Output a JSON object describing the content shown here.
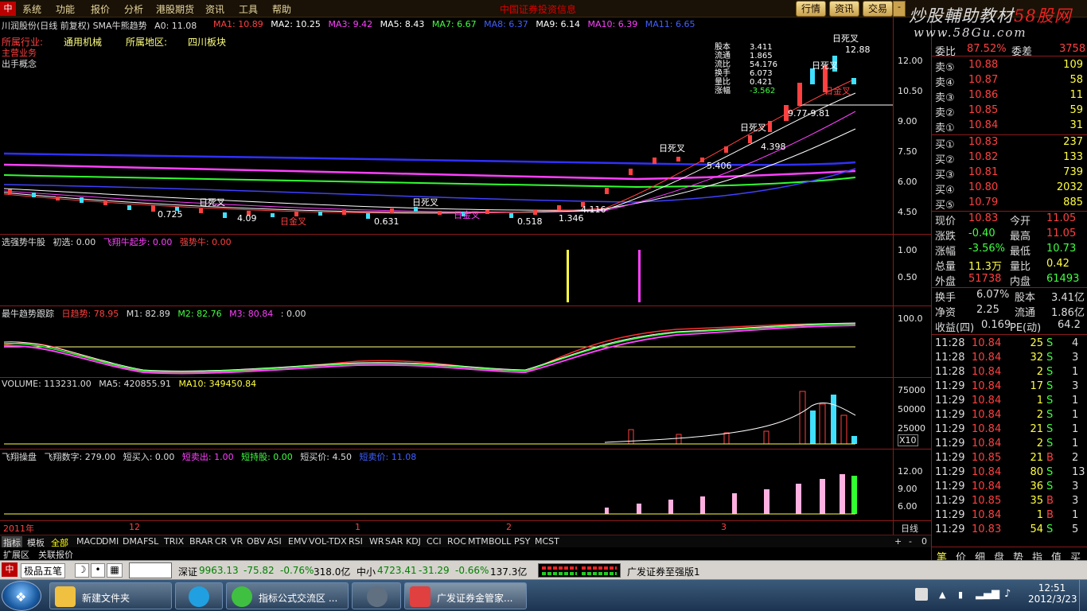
{
  "menubar": {
    "logo": "中",
    "items": [
      "系统",
      "功能",
      "报价",
      "分析",
      "港股期货",
      "资讯",
      "工具",
      "帮助"
    ],
    "center_title": "中国证券投资信息",
    "tabs": [
      "行情",
      "资讯",
      "交易"
    ],
    "minimize": "-"
  },
  "watermark": {
    "text": "炒股輔助教材",
    "accent": "58股网",
    "url": "www.58Gu.com"
  },
  "main_chart": {
    "title": "川润股份(日线 前复权) SMA牛熊趋势",
    "a0": "A0: 11.08",
    "ma": [
      {
        "label": "MA1: 10.89",
        "color": "#ff4040"
      },
      {
        "label": "MA2: 10.25",
        "color": "#ffffff"
      },
      {
        "label": "MA3: 9.42",
        "color": "#ff40ff"
      },
      {
        "label": "MA5: 8.43",
        "color": "#ffffff"
      },
      {
        "label": "MA7: 6.67",
        "color": "#40ff40"
      },
      {
        "label": "MA8: 6.37",
        "color": "#4040ff"
      },
      {
        "label": "MA9: 6.14",
        "color": "#ffffff"
      },
      {
        "label": "MA10: 6.39",
        "color": "#ff40ff"
      },
      {
        "label": "MA11: 6.65",
        "color": "#4040ff"
      }
    ],
    "info": {
      "industry_label": "所属行业:",
      "industry": "通用机械",
      "region_label": "所属地区:",
      "region": "四川板块",
      "line3": "主营业务",
      "line4": "出手概念"
    },
    "stats": [
      {
        "k": "股本",
        "v": "3.411"
      },
      {
        "k": "流通",
        "v": "1.865"
      },
      {
        "k": "流比",
        "v": "54.176"
      },
      {
        "k": "换手",
        "v": "6.073"
      },
      {
        "k": "量比",
        "v": "0.421"
      },
      {
        "k": "涨幅",
        "v": "-3.562"
      }
    ],
    "axis": [
      "12.00",
      "10.50",
      "9.00",
      "7.50",
      "6.00",
      "4.50"
    ],
    "annotations": {
      "dead_cross": "日死叉",
      "gold_cross": "日金叉",
      "v725": "0.725",
      "v409": "4.09",
      "v631": "0.631",
      "v518": "0.518",
      "v1346": "1.346",
      "v4116": "4.116",
      "v5406": "5.406",
      "v4398": "4.398",
      "v977": "9.77-9.81",
      "v1288": "12.88"
    }
  },
  "panel2": {
    "name": "选强势牛股",
    "items": [
      {
        "label": "初选: 0.00",
        "color": "#dddddd"
      },
      {
        "label": "飞翔牛起步: 0.00",
        "color": "#ff40ff"
      },
      {
        "label": "强势牛: 0.00",
        "color": "#ff4040"
      }
    ],
    "axis": [
      "1.00",
      "0.50"
    ]
  },
  "panel3": {
    "name": "最牛趋势跟踪",
    "items": [
      {
        "label": "日趋势: 78.95",
        "color": "#ff4040"
      },
      {
        "label": "M1: 82.89",
        "color": "#dddddd"
      },
      {
        "label": "M2: 82.76",
        "color": "#40ff40"
      },
      {
        "label": "M3: 80.84",
        "color": "#ff40ff"
      },
      {
        "label": ": 0.00",
        "color": "#dddddd"
      }
    ],
    "axis": [
      "100.0"
    ]
  },
  "panel4": {
    "name": "VOLUME: 113231.00",
    "items": [
      {
        "label": "MA5: 420855.91",
        "color": "#dddddd"
      },
      {
        "label": "MA10: 349450.84",
        "color": "#ffff40"
      }
    ],
    "axis": [
      "75000",
      "50000",
      "25000"
    ],
    "multiplier": "X10"
  },
  "panel5": {
    "name": "飞翔操盘",
    "items": [
      {
        "label": "飞翔数字: 279.00",
        "color": "#dddddd"
      },
      {
        "label": "短买入: 0.00",
        "color": "#dddddd"
      },
      {
        "label": "短卖出: 1.00",
        "color": "#ff40ff"
      },
      {
        "label": "短持股: 0.00",
        "color": "#40ff40"
      },
      {
        "label": "短买价: 4.50",
        "color": "#dddddd"
      },
      {
        "label": "短卖价: 11.08",
        "color": "#4060ff"
      }
    ],
    "axis": [
      "12.00",
      "9.00",
      "6.00"
    ]
  },
  "date_axis": {
    "labels": [
      "2011年",
      "12",
      "1",
      "2",
      "3"
    ],
    "period": "日线"
  },
  "indicator_tabs": [
    "指标",
    "模板",
    "全部",
    "MACD",
    "DMI",
    "DMA",
    "FSL",
    "TRIX",
    "BRAR",
    "CR",
    "VR",
    "OBV",
    "ASI",
    "EMV",
    "VOL-TDX",
    "RSI",
    "WR",
    "SAR",
    "KDJ",
    "CCI",
    "ROC",
    "MTM",
    "BOLL",
    "PSY",
    "MCST"
  ],
  "strip_controls": [
    "+",
    "-",
    "0"
  ],
  "bottom_tabs": [
    "扩展区",
    "关联报价"
  ],
  "right_panel": {
    "weibi": {
      "label": "委比",
      "value": "87.52%",
      "label2": "委差",
      "value2": "3758"
    },
    "asks": [
      {
        "label": "卖⑤",
        "price": "10.88",
        "vol": "109"
      },
      {
        "label": "卖④",
        "price": "10.87",
        "vol": "58"
      },
      {
        "label": "卖③",
        "price": "10.86",
        "vol": "11"
      },
      {
        "label": "卖②",
        "price": "10.85",
        "vol": "59"
      },
      {
        "label": "卖①",
        "price": "10.84",
        "vol": "31"
      }
    ],
    "bids": [
      {
        "label": "买①",
        "price": "10.83",
        "vol": "237"
      },
      {
        "label": "买②",
        "price": "10.82",
        "vol": "133"
      },
      {
        "label": "买③",
        "price": "10.81",
        "vol": "739"
      },
      {
        "label": "买④",
        "price": "10.80",
        "vol": "2032"
      },
      {
        "label": "买⑤",
        "price": "10.79",
        "vol": "885"
      }
    ],
    "quote": [
      {
        "k1": "现价",
        "v1": "10.83",
        "c1": "#ff4040",
        "k2": "今开",
        "v2": "11.05",
        "c2": "#ff4040"
      },
      {
        "k1": "涨跌",
        "v1": "-0.40",
        "c1": "#40ff40",
        "k2": "最高",
        "v2": "11.05",
        "c2": "#ff4040"
      },
      {
        "k1": "涨幅",
        "v1": "-3.56%",
        "c1": "#40ff40",
        "k2": "最低",
        "v2": "10.73",
        "c2": "#40ff40"
      },
      {
        "k1": "总量",
        "v1": "11.3万",
        "c1": "#ffff40",
        "k2": "量比",
        "v2": "0.42",
        "c2": "#ffff40"
      },
      {
        "k1": "外盘",
        "v1": "51738",
        "c1": "#ff4040",
        "k2": "内盘",
        "v2": "61493",
        "c2": "#40ff40"
      }
    ],
    "finance": [
      {
        "k1": "换手",
        "v1": "6.07%",
        "k2": "股本",
        "v2": "3.41亿"
      },
      {
        "k1": "净资",
        "v1": "2.25",
        "k2": "流通",
        "v2": "1.86亿"
      },
      {
        "k1": "收益(四)",
        "v1": "0.169",
        "k2": "PE(动)",
        "v2": "64.2"
      }
    ],
    "ticks": [
      {
        "t": "11:28",
        "p": "10.84",
        "v": "25",
        "s": "S",
        "n": "4"
      },
      {
        "t": "11:28",
        "p": "10.84",
        "v": "32",
        "s": "S",
        "n": "3"
      },
      {
        "t": "11:28",
        "p": "10.84",
        "v": "2",
        "s": "S",
        "n": "1"
      },
      {
        "t": "11:29",
        "p": "10.84",
        "v": "17",
        "s": "S",
        "n": "3"
      },
      {
        "t": "11:29",
        "p": "10.84",
        "v": "1",
        "s": "S",
        "n": "1"
      },
      {
        "t": "11:29",
        "p": "10.84",
        "v": "2",
        "s": "S",
        "n": "1"
      },
      {
        "t": "11:29",
        "p": "10.84",
        "v": "21",
        "s": "S",
        "n": "1"
      },
      {
        "t": "11:29",
        "p": "10.84",
        "v": "2",
        "s": "S",
        "n": "1"
      },
      {
        "t": "11:29",
        "p": "10.85",
        "v": "21",
        "s": "B",
        "n": "2"
      },
      {
        "t": "11:29",
        "p": "10.84",
        "v": "80",
        "s": "S",
        "n": "13"
      },
      {
        "t": "11:29",
        "p": "10.84",
        "v": "36",
        "s": "S",
        "n": "3"
      },
      {
        "t": "11:29",
        "p": "10.85",
        "v": "35",
        "s": "B",
        "n": "3"
      },
      {
        "t": "11:29",
        "p": "10.84",
        "v": "1",
        "s": "B",
        "n": "1"
      },
      {
        "t": "11:29",
        "p": "10.83",
        "v": "54",
        "s": "S",
        "n": "5"
      }
    ],
    "tabs": [
      "笔",
      "价",
      "细",
      "盘",
      "势",
      "指",
      "值",
      "买"
    ]
  },
  "statusbar": {
    "logo": "中",
    "brand": "极品五笔",
    "sz_label": "深证",
    "sz_val": "9963.13",
    "sz_chg": "-75.82",
    "sz_pct": "-0.76%",
    "sz_amt": "318.0亿",
    "zx_label": "中小",
    "zx_val": "4723.41",
    "zx_chg": "-31.29",
    "zx_pct": "-0.66%",
    "zx_amt": "137.3亿",
    "broker": "广发证券至强版1"
  },
  "taskbar": {
    "tasks": [
      {
        "label": "新建文件夹",
        "icon_color": "#f0c040"
      },
      {
        "label": "",
        "icon_color": "#20a0e0"
      },
      {
        "label": "指标公式交流区 ...",
        "icon_color": "#40c040"
      },
      {
        "label": "",
        "icon_color": "#607080"
      },
      {
        "label": "广发证券金管家...",
        "icon_color": "#e04040"
      }
    ],
    "time": "12:51",
    "date": "2012/3/23"
  }
}
